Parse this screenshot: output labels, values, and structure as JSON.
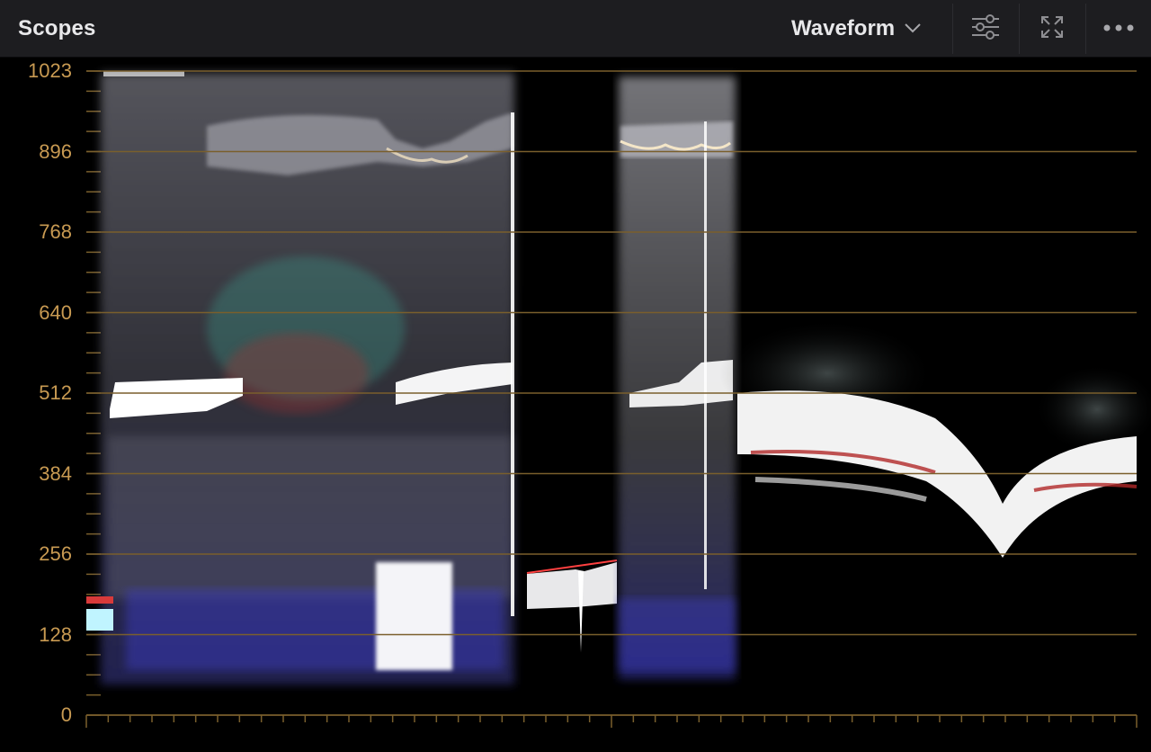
{
  "header": {
    "title": "Scopes",
    "mode": {
      "label": "Waveform",
      "icon": "chevron-down-icon"
    },
    "buttons": [
      {
        "name": "scope-settings-button",
        "icon": "sliders-icon"
      },
      {
        "name": "expand-scope-button",
        "icon": "expand-icon"
      },
      {
        "name": "more-options-button",
        "icon": "more-icon"
      }
    ]
  },
  "scope": {
    "type": "waveform",
    "y_axis": {
      "min": 0,
      "max": 1023,
      "labels": [
        "1023",
        "896",
        "768",
        "640",
        "512",
        "384",
        "256",
        "128",
        "0"
      ]
    },
    "colors": {
      "background": "#000000",
      "graticule": "#7a5f2c",
      "label": "#c89a52",
      "trace": "#ffffff"
    }
  }
}
